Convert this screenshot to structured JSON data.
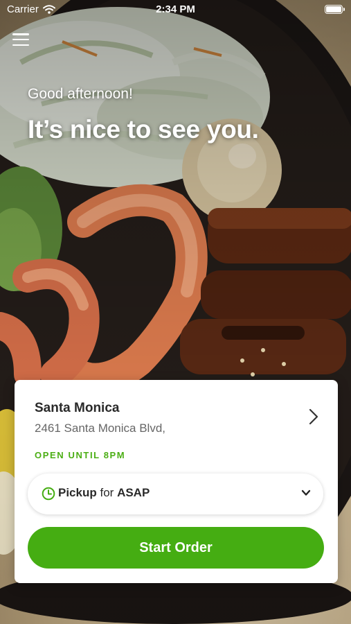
{
  "status_bar": {
    "carrier": "Carrier",
    "time": "2:34 PM",
    "icons": [
      "wifi-icon",
      "battery-icon"
    ]
  },
  "header": {
    "menu_icon": "hamburger-menu-icon",
    "greeting": "Good afternoon!",
    "headline": "It’s nice to see you."
  },
  "location_card": {
    "store_name": "Santa Monica",
    "address": "2461 Santa Monica Blvd,",
    "open_status": "OPEN UNTIL 8PM",
    "order_mode": {
      "icon": "clock-icon",
      "method": "Pickup",
      "connector": "for",
      "time": "ASAP"
    },
    "start_order_label": "Start Order"
  },
  "colors": {
    "accent_green": "#45ad12",
    "status_green": "#4bae14",
    "text_dark": "#2a2a2a",
    "text_muted": "#666666"
  }
}
